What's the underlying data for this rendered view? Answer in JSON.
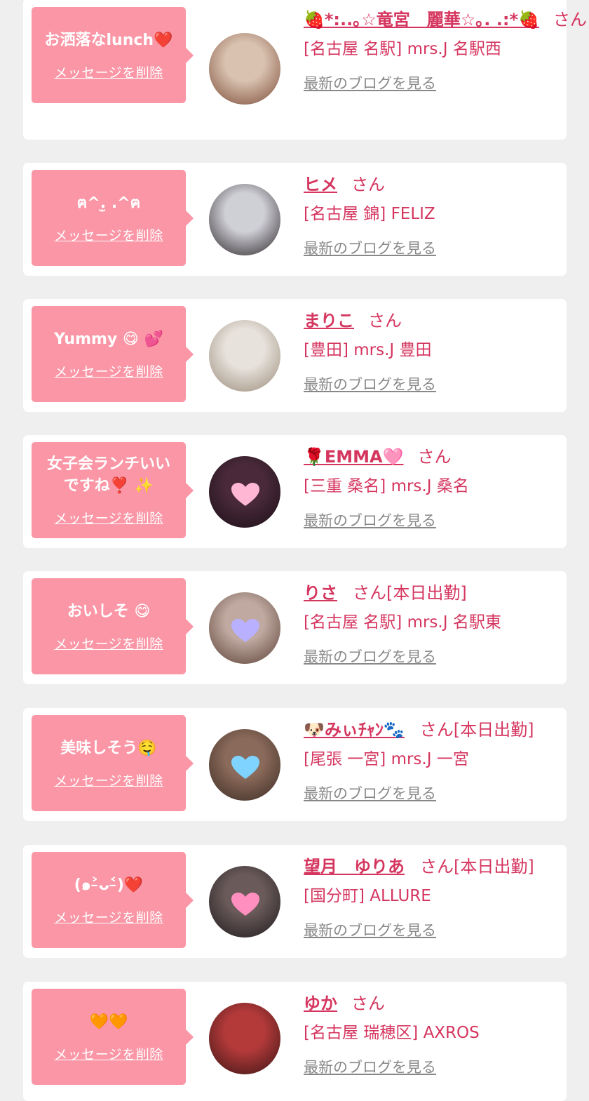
{
  "labels": {
    "delete": "メッセージを削除",
    "blog": "最新のブログを見る"
  },
  "colors": {
    "bubble": "#fa96a6",
    "accent": "#d5365f",
    "link_gray": "#888888",
    "background": "#efefef"
  },
  "items": [
    {
      "message": "お洒落なlunch❤️",
      "name": "🍓*:..｡☆竜宮　麗華☆｡. .:*🍓",
      "suffix": "さん",
      "shop": "[名古屋 名駅] mrs.J 名駅西",
      "avatar": {
        "icon": "avatar-photo",
        "colors": [
          "#d9c2b0",
          "#7a4a36"
        ],
        "heart": false
      }
    },
    {
      "message": "ฅ^.̫ .^ฅ",
      "name": "ヒメ",
      "suffix": "さん",
      "shop": "[名古屋 錦] FELIZ",
      "avatar": {
        "icon": "avatar-photo",
        "colors": [
          "#cfcfd6",
          "#2a2426"
        ],
        "heart": false
      }
    },
    {
      "message": "Yummy 😋 💕",
      "name": "まりこ",
      "suffix": "さん",
      "shop": "[豊田] mrs.J 豊田",
      "avatar": {
        "icon": "avatar-photo",
        "colors": [
          "#e7e2dc",
          "#9a8a78"
        ],
        "heart": false
      }
    },
    {
      "message": "女子会ランチいいですね❣️ ✨",
      "name": "🌹EMMA🩷",
      "suffix": "さん",
      "shop": "[三重 桑名] mrs.J 桑名",
      "avatar": {
        "icon": "avatar-photo",
        "colors": [
          "#4a2a3a",
          "#1a0e16"
        ],
        "heart": true,
        "heart_color": "#ffb7d3"
      }
    },
    {
      "message": "おいしそ 😋",
      "name": "りさ",
      "suffix": "さん[本日出勤]",
      "shop": "[名古屋 名駅] mrs.J 名駅東",
      "avatar": {
        "icon": "avatar-photo",
        "colors": [
          "#bfa9a0",
          "#5b4036"
        ],
        "heart": true,
        "heart_color": "#b9b0ff"
      }
    },
    {
      "message": "美味しそう🤤",
      "name": "🐶みぃﾁｬﾝ🐾",
      "suffix": "さん[本日出勤]",
      "shop": "[尾張 一宮] mrs.J 一宮",
      "avatar": {
        "icon": "avatar-photo",
        "colors": [
          "#8a6a5a",
          "#3a2a22"
        ],
        "heart": true,
        "heart_color": "#7fd3ff"
      }
    },
    {
      "message": "(๑˃̵ᴗ˂̵)❤️",
      "name": "望月　ゆりあ",
      "suffix": "さん[本日出勤]",
      "shop": "[国分町] ALLURE",
      "avatar": {
        "icon": "avatar-photo",
        "colors": [
          "#6a5a5a",
          "#1e1a1c"
        ],
        "heart": true,
        "heart_color": "#ff8fbf"
      }
    },
    {
      "message": "🧡🧡",
      "name": "ゆか",
      "suffix": "さん",
      "shop": "[名古屋 瑞穂区] AXROS",
      "avatar": {
        "icon": "avatar-photo",
        "colors": [
          "#b43a3a",
          "#3a1414"
        ],
        "heart": false
      }
    }
  ]
}
